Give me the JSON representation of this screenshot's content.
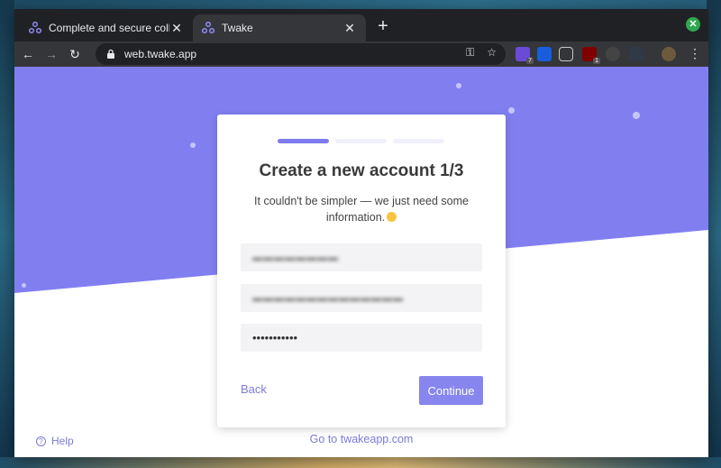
{
  "browser": {
    "tabs": [
      {
        "title": "Complete and secure collabo",
        "active": false
      },
      {
        "title": "Twake",
        "active": true
      }
    ],
    "new_tab_label": "+",
    "url": "web.twake.app",
    "extensions": [
      {
        "icon": "purple-extension-icon",
        "badge": "7"
      },
      {
        "icon": "bitwarden-icon",
        "badge": ""
      },
      {
        "icon": "pocket-icon",
        "badge": ""
      },
      {
        "icon": "ublock-icon",
        "badge": "1"
      },
      {
        "icon": "mask-extension-icon",
        "badge": ""
      },
      {
        "icon": "lt-extension-icon",
        "badge": ""
      }
    ]
  },
  "signup": {
    "title": "Create a new account 1/3",
    "subtitle": "It couldn't be simpler — we just need some information.",
    "progress_steps": 3,
    "progress_current": 1,
    "fields": {
      "name_value": "▬▬▬▬▬▬▬▬",
      "email_value": "▬▬▬▬▬▬▬▬▬▬▬▬▬▬",
      "password_value": "•••••••••••"
    },
    "back_label": "Back",
    "continue_label": "Continue"
  },
  "footer": {
    "help_label": "Help",
    "goto_label": "Go to twakeapp.com"
  },
  "colors": {
    "accent": "#7e7bee",
    "hero": "#817ff0",
    "browser_dark": "#202124",
    "browser_toolbar": "#35363a"
  }
}
